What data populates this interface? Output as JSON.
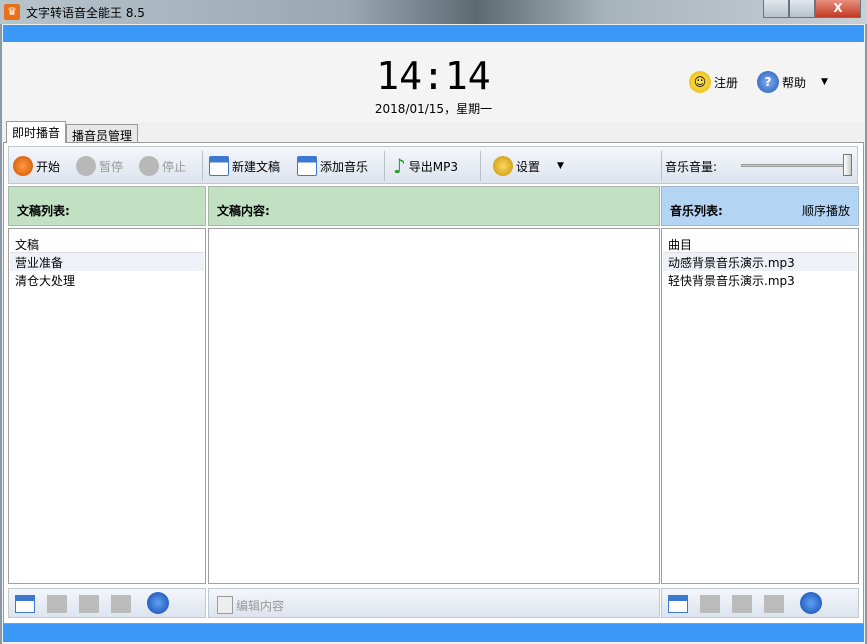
{
  "window": {
    "title": "文字转语音全能王 8.5",
    "close": "X"
  },
  "header": {
    "time": "14:14",
    "date": "2018/01/15，星期一",
    "register": "注册",
    "help": "帮助"
  },
  "tabs": [
    {
      "label": "即时播音"
    },
    {
      "label": "播音员管理"
    }
  ],
  "toolbar": {
    "start": "开始",
    "pause": "暂停",
    "stop": "停止",
    "new_doc": "新建文稿",
    "add_music": "添加音乐",
    "export": "导出MP3",
    "settings": "设置",
    "volume_label": "音乐音量:",
    "volume_percent": 100
  },
  "docs": {
    "title": "文稿列表:",
    "column": "文稿",
    "items": [
      "营业准备",
      "清仓大处理"
    ]
  },
  "content": {
    "title": "文稿内容:",
    "edit": "编辑内容"
  },
  "music": {
    "title": "音乐列表:",
    "mode": "顺序播放",
    "column": "曲目",
    "items": [
      "动感背景音乐演示.mp3",
      "轻快背景音乐演示.mp3"
    ]
  }
}
